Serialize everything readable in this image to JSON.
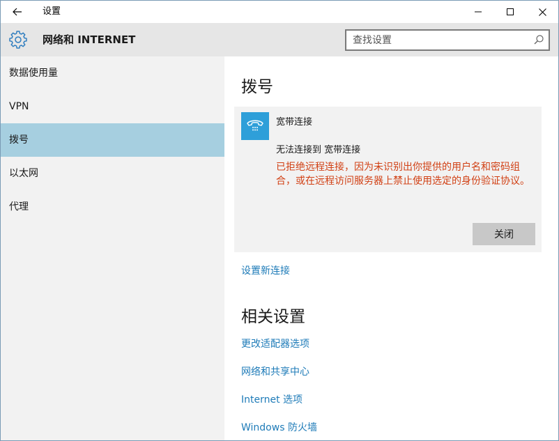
{
  "titlebar": {
    "app_title": "设置",
    "back_icon": "back-arrow-icon",
    "minimize_icon": "minimize-icon",
    "maximize_icon": "maximize-icon",
    "close_icon": "close-icon"
  },
  "header": {
    "title": "网络和 INTERNET",
    "icon": "gear-icon",
    "search_placeholder": "查找设置",
    "search_value": ""
  },
  "sidebar": {
    "items": [
      {
        "label": "数据使用量",
        "active": false
      },
      {
        "label": "VPN",
        "active": false
      },
      {
        "label": "拨号",
        "active": true
      },
      {
        "label": "以太网",
        "active": false
      },
      {
        "label": "代理",
        "active": false
      }
    ],
    "active_color": "#a6cfe0"
  },
  "main": {
    "heading": "拨号",
    "connection": {
      "name": "宽带连接",
      "icon": "dialup-phone-icon",
      "error_title": "无法连接到 宽带连接",
      "error_message": "已拒绝远程连接，因为未识别出你提供的用户名和密码组合，或在远程访问服务器上禁止使用选定的身份验证协议。",
      "close_label": "关闭"
    },
    "setup_link": "设置新连接",
    "related_heading": "相关设置",
    "related_links": [
      "更改适配器选项",
      "网络和共享中心",
      "Internet 选项",
      "Windows 防火墙"
    ]
  },
  "colors": {
    "accent": "#1e7bb8",
    "error": "#d14014",
    "icon_bg": "#2e9fd9"
  }
}
